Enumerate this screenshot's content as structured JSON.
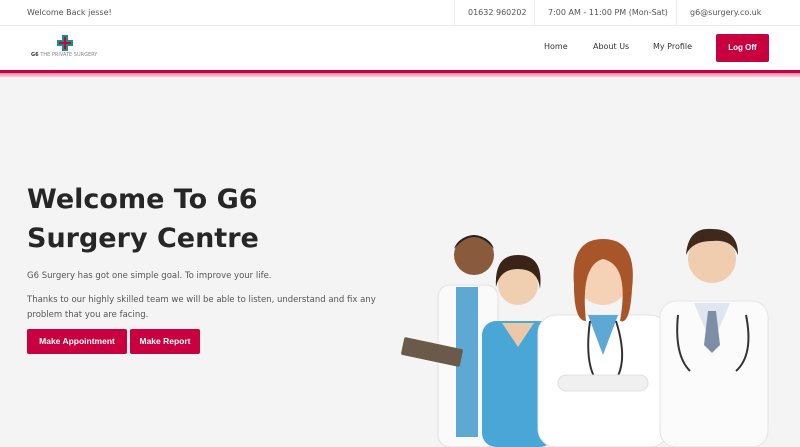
{
  "topbar": {
    "welcome": "Welcome Back jesse!",
    "phone": "01632 960202",
    "hours": "7:00 AM - 11:00 PM (Mon-Sat)",
    "email": "g6@surgery.co.uk"
  },
  "header": {
    "logo_brand": "G6",
    "logo_name": "THE PRIVATE SURGERY",
    "nav": [
      "Home",
      "About Us",
      "My Profile"
    ],
    "logoff_label": "Log Off"
  },
  "hero": {
    "title": "Welcome To G6 Surgery Centre",
    "paragraph1": "G6 Surgery has got one simple goal. To improve your life.",
    "paragraph2": "Thanks to our highly skilled team we will be able to listen, understand and fix any problem that you are facing.",
    "appointment_label": "Make Appointment",
    "report_label": "Make Report"
  },
  "colors": {
    "brand": "#c8003f",
    "logo_teal": "#1a8f8a",
    "background": "#f4f4f4"
  },
  "icons": {
    "logo": "medical-cross-icon"
  }
}
